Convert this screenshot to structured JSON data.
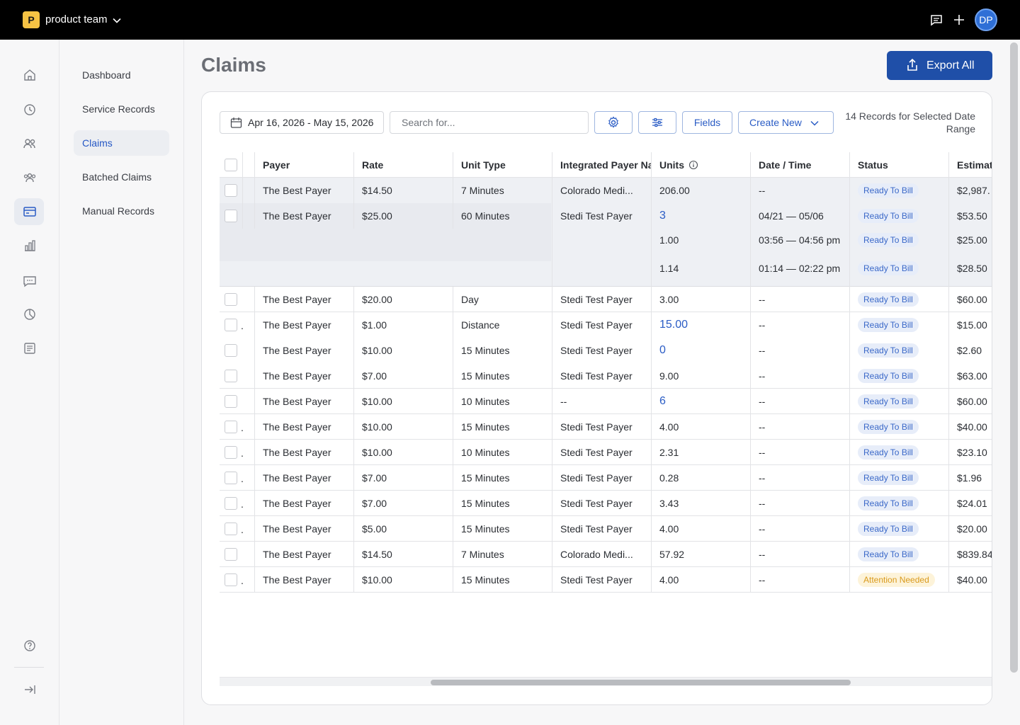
{
  "workspace": {
    "logo_letter": "P",
    "name": "product team"
  },
  "user": {
    "initials": "DP"
  },
  "subnav": [
    "Dashboard",
    "Service Records",
    "Claims",
    "Batched Claims",
    "Manual Records"
  ],
  "page": {
    "title": "Claims",
    "export_label": "Export All"
  },
  "toolbar": {
    "date_range": "Apr 16, 2026 - May 15, 2026",
    "search_placeholder": "Search for...",
    "fields_label": "Fields",
    "create_label": "Create New",
    "record_count": "14 Records for Selected Date Range"
  },
  "table": {
    "headers": [
      "Payer",
      "Rate",
      "Unit Type",
      "Integrated Payer Na",
      "Units",
      "Date / Time",
      "Status",
      "Estimat"
    ],
    "expanded_row": {
      "payer": "The Best Payer",
      "rate": "$25.00",
      "unit_type": "60 Minutes",
      "integrated": "Stedi Test Payer",
      "units": "3",
      "date": "04/21 — 05/06",
      "status": "Ready To Bill",
      "estimate": "$53.50",
      "children": [
        {
          "units": "1.00",
          "date": "03:56 — 04:56 pm",
          "status": "Ready To Bill",
          "estimate": "$25.00"
        },
        {
          "units": "1.14",
          "date": "01:14 — 02:22 pm",
          "status": "Ready To Bill",
          "estimate": "$28.50"
        }
      ]
    },
    "rows": [
      {
        "payer": "The Best Payer",
        "rate": "$14.50",
        "unit_type": "7 Minutes",
        "integrated": "Colorado Medi...",
        "units": "206.00",
        "date": "--",
        "status": "Ready To Bill",
        "estimate": "$2,987."
      },
      {
        "payer": "The Best Payer",
        "rate": "$20.00",
        "unit_type": "Day",
        "integrated": "Stedi Test Payer",
        "units": "3.00",
        "date": "--",
        "status": "Ready To Bill",
        "estimate": "$60.00"
      },
      {
        "payer": "The Best Payer",
        "rate": "$1.00",
        "unit_type": "Distance",
        "integrated": "Stedi Test Payer",
        "units": "15.00",
        "date": "--",
        "status": "Ready To Bill",
        "estimate": "$15.00"
      },
      {
        "payer": "The Best Payer",
        "rate": "$10.00",
        "unit_type": "15 Minutes",
        "integrated": "Stedi Test Payer",
        "units": "0",
        "date": "--",
        "status": "Ready To Bill",
        "estimate": "$2.60"
      },
      {
        "payer": "The Best Payer",
        "rate": "$7.00",
        "unit_type": "15 Minutes",
        "integrated": "Stedi Test Payer",
        "units": "9.00",
        "date": "--",
        "status": "Ready To Bill",
        "estimate": "$63.00"
      },
      {
        "payer": "The Best Payer",
        "rate": "$10.00",
        "unit_type": "10 Minutes",
        "integrated": "--",
        "units": "6",
        "date": "--",
        "status": "Ready To Bill",
        "estimate": "$60.00"
      },
      {
        "payer": "The Best Payer",
        "rate": "$10.00",
        "unit_type": "15 Minutes",
        "integrated": "Stedi Test Payer",
        "units": "4.00",
        "date": "--",
        "status": "Ready To Bill",
        "estimate": "$40.00"
      },
      {
        "payer": "The Best Payer",
        "rate": "$10.00",
        "unit_type": "10 Minutes",
        "integrated": "Stedi Test Payer",
        "units": "2.31",
        "date": "--",
        "status": "Ready To Bill",
        "estimate": "$23.10"
      },
      {
        "payer": "The Best Payer",
        "rate": "$7.00",
        "unit_type": "15 Minutes",
        "integrated": "Stedi Test Payer",
        "units": "0.28",
        "date": "--",
        "status": "Ready To Bill",
        "estimate": "$1.96"
      },
      {
        "payer": "The Best Payer",
        "rate": "$7.00",
        "unit_type": "15 Minutes",
        "integrated": "Stedi Test Payer",
        "units": "3.43",
        "date": "--",
        "status": "Ready To Bill",
        "estimate": "$24.01"
      },
      {
        "payer": "The Best Payer",
        "rate": "$5.00",
        "unit_type": "15 Minutes",
        "integrated": "Stedi Test Payer",
        "units": "4.00",
        "date": "--",
        "status": "Ready To Bill",
        "estimate": "$20.00"
      },
      {
        "payer": "The Best Payer",
        "rate": "$14.50",
        "unit_type": "7 Minutes",
        "integrated": "Colorado Medi...",
        "units": "57.92",
        "date": "--",
        "status": "Ready To Bill",
        "estimate": "$839.84"
      },
      {
        "payer": "The Best Payer",
        "rate": "$10.00",
        "unit_type": "15 Minutes",
        "integrated": "Stedi Test Payer",
        "units": "4.00",
        "date": "--",
        "status": "Attention Needed",
        "estimate": "$40.00"
      }
    ]
  }
}
